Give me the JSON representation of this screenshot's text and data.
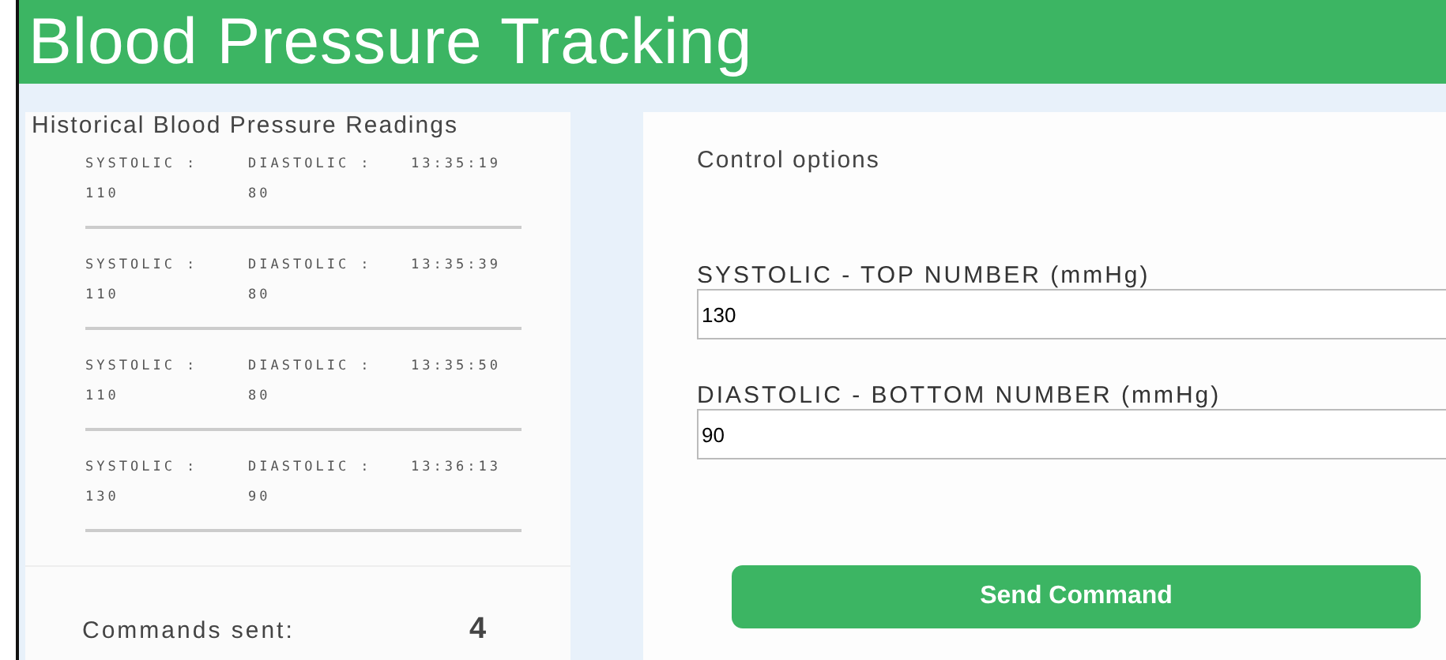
{
  "header": {
    "title": "Blood Pressure Tracking"
  },
  "history": {
    "title": "Historical Blood Pressure Readings",
    "readings": [
      {
        "systolic_label": "SYSTOLIC :",
        "diastolic_label": "DIASTOLIC :",
        "time": "13:35:19",
        "systolic": "110",
        "diastolic": "80"
      },
      {
        "systolic_label": "SYSTOLIC :",
        "diastolic_label": "DIASTOLIC :",
        "time": "13:35:39",
        "systolic": "110",
        "diastolic": "80"
      },
      {
        "systolic_label": "SYSTOLIC :",
        "diastolic_label": "DIASTOLIC :",
        "time": "13:35:50",
        "systolic": "110",
        "diastolic": "80"
      },
      {
        "systolic_label": "SYSTOLIC :",
        "diastolic_label": "DIASTOLIC :",
        "time": "13:36:13",
        "systolic": "130",
        "diastolic": "90"
      }
    ],
    "commands_label": "Commands sent:",
    "commands_count": "4"
  },
  "controls": {
    "title": "Control options",
    "fields": [
      {
        "label": "SYSTOLIC - TOP NUMBER (mmHg)",
        "value": "130"
      },
      {
        "label": "DIASTOLIC - BOTTOM NUMBER (mmHg)",
        "value": "90"
      }
    ],
    "button": "Send Command"
  }
}
